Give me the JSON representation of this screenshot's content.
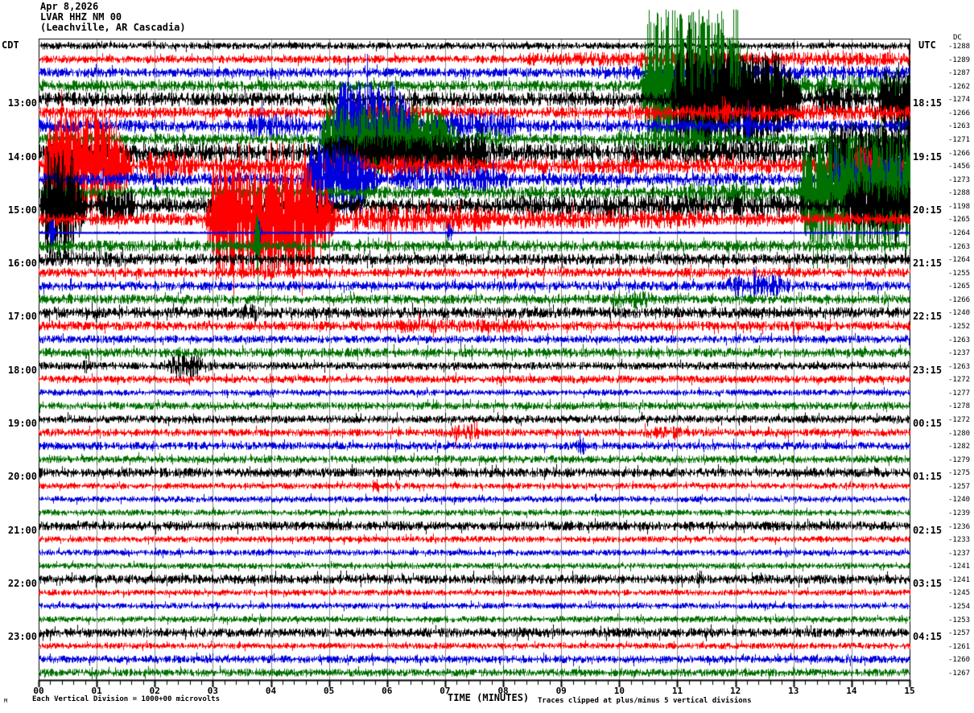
{
  "title": {
    "date": "Apr 8,2026",
    "station": "LVAR HHZ NM 00",
    "location": "(Leachville, AR Cascadia)"
  },
  "header": {
    "left_timezone": "CDT",
    "right_timezone": "UTC",
    "dc_label": "DC"
  },
  "footer": {
    "left": "Each Vertical Division = 1000+00 microvolts",
    "center": "TIME (MINUTES)",
    "right": "Traces clipped at plus/minus 5 vertical divisions",
    "watermark": "M"
  },
  "chart_data": {
    "type": "line",
    "subtype": "helicorder-seismogram",
    "xlabel": "TIME (MINUTES)",
    "x_ticks": [
      "00",
      "01",
      "02",
      "03",
      "04",
      "05",
      "06",
      "07",
      "08",
      "09",
      "10",
      "11",
      "12",
      "13",
      "14",
      "15"
    ],
    "xlim": [
      0,
      15
    ],
    "minutes_per_row": 15,
    "rows_per_hour": 4,
    "grid": true,
    "clip_divisions": 5,
    "colors": {
      "black": "#000000",
      "red": "#ff0000",
      "blue": "#0000dd",
      "green": "#007000",
      "grid": "#8a8a8a"
    },
    "left_time_labels": [
      {
        "row": 5,
        "text": "13:00"
      },
      {
        "row": 9,
        "text": "14:00"
      },
      {
        "row": 13,
        "text": "15:00"
      },
      {
        "row": 17,
        "text": "16:00"
      },
      {
        "row": 21,
        "text": "17:00"
      },
      {
        "row": 25,
        "text": "18:00"
      },
      {
        "row": 29,
        "text": "19:00"
      },
      {
        "row": 33,
        "text": "20:00"
      },
      {
        "row": 37,
        "text": "21:00"
      },
      {
        "row": 41,
        "text": "22:00"
      },
      {
        "row": 45,
        "text": "23:00"
      }
    ],
    "right_time_labels": [
      {
        "row": 5,
        "text": "18:15"
      },
      {
        "row": 9,
        "text": "19:15"
      },
      {
        "row": 13,
        "text": "20:15"
      },
      {
        "row": 17,
        "text": "21:15"
      },
      {
        "row": 21,
        "text": "22:15"
      },
      {
        "row": 25,
        "text": "23:15"
      },
      {
        "row": 29,
        "text": "00:15"
      },
      {
        "row": 33,
        "text": "01:15"
      },
      {
        "row": 37,
        "text": "02:15"
      },
      {
        "row": 41,
        "text": "03:15"
      },
      {
        "row": 45,
        "text": "04:15"
      }
    ],
    "rows": [
      {
        "color": "black",
        "dc": -1288,
        "noise": 4.5,
        "events": []
      },
      {
        "color": "red",
        "dc": -1289,
        "noise": 5,
        "events": [
          [
            8.3,
            15,
            9
          ]
        ]
      },
      {
        "color": "blue",
        "dc": -1287,
        "noise": 6,
        "events": [
          [
            9.5,
            15,
            9
          ]
        ]
      },
      {
        "color": "green",
        "dc": -1262,
        "noise": 7,
        "events": [
          [
            10.35,
            12.4,
            95
          ],
          [
            12.4,
            15,
            14
          ]
        ]
      },
      {
        "color": "black",
        "dc": -1274,
        "noise": 9,
        "events": [
          [
            10.85,
            13.3,
            62
          ],
          [
            13.3,
            14.4,
            20
          ],
          [
            14.4,
            15,
            40
          ]
        ]
      },
      {
        "color": "red",
        "dc": -1266,
        "noise": 7,
        "events": [
          [
            5.3,
            7.0,
            13
          ],
          [
            10,
            15,
            10
          ],
          [
            11.7,
            11.95,
            26
          ]
        ]
      },
      {
        "color": "blue",
        "dc": -1263,
        "noise": 8,
        "events": [
          [
            3.5,
            5.0,
            16
          ],
          [
            5.0,
            6.7,
            55
          ],
          [
            6.7,
            8.6,
            18
          ],
          [
            12.1,
            12.35,
            22
          ]
        ]
      },
      {
        "color": "green",
        "dc": -1271,
        "noise": 7,
        "events": [
          [
            4.8,
            7.4,
            45
          ],
          [
            7.4,
            8.2,
            15
          ],
          [
            9.8,
            12,
            12
          ]
        ]
      },
      {
        "color": "black",
        "dc": -1266,
        "noise": 12,
        "events": [
          [
            4.8,
            8.2,
            22
          ],
          [
            10,
            13.5,
            15
          ],
          [
            13.5,
            15,
            38
          ]
        ]
      },
      {
        "color": "red",
        "dc": -1456,
        "noise": 10,
        "events": [
          [
            0.05,
            1.75,
            70
          ],
          [
            1.75,
            3,
            18
          ],
          [
            5,
            8,
            14
          ],
          [
            13.9,
            14.6,
            25
          ]
        ]
      },
      {
        "color": "blue",
        "dc": -1273,
        "noise": 8,
        "events": [
          [
            4.55,
            6.0,
            45
          ],
          [
            6.0,
            8.5,
            16
          ],
          [
            13.6,
            15,
            34
          ]
        ]
      },
      {
        "color": "green",
        "dc": -1288,
        "noise": 8,
        "events": [
          [
            11,
            13,
            14
          ],
          [
            13.05,
            15,
            72
          ]
        ]
      },
      {
        "color": "black",
        "dc": -1198,
        "noise": 10,
        "events": [
          [
            0,
            0.9,
            70
          ],
          [
            0.9,
            2,
            20
          ],
          [
            8,
            13.8,
            14
          ],
          [
            13.8,
            15,
            32
          ]
        ]
      },
      {
        "color": "red",
        "dc": -1265,
        "noise": 8,
        "events": [
          [
            2.85,
            5.25,
            75
          ],
          [
            5.25,
            8.2,
            18
          ],
          [
            8.2,
            12,
            12
          ]
        ]
      },
      {
        "color": "blue",
        "dc": -1264,
        "noise": 1.5,
        "line": true,
        "events": [
          [
            0.15,
            0.3,
            20
          ],
          [
            3.7,
            3.85,
            26
          ],
          [
            7.0,
            7.15,
            12
          ]
        ]
      },
      {
        "color": "green",
        "dc": -1263,
        "noise": 7,
        "events": [
          [
            0.25,
            0.4,
            16
          ],
          [
            3.7,
            3.82,
            45
          ]
        ]
      },
      {
        "color": "black",
        "dc": -1264,
        "noise": 7,
        "events": [
          [
            0,
            2,
            10
          ]
        ]
      },
      {
        "color": "red",
        "dc": -1255,
        "noise": 6,
        "events": []
      },
      {
        "color": "blue",
        "dc": -1265,
        "noise": 6,
        "events": [
          [
            11.75,
            13.3,
            15
          ]
        ]
      },
      {
        "color": "green",
        "dc": -1266,
        "noise": 6,
        "events": [
          [
            9.7,
            10.9,
            12
          ]
        ]
      },
      {
        "color": "black",
        "dc": -1240,
        "noise": 7,
        "events": [
          [
            3.4,
            3.9,
            14
          ]
        ]
      },
      {
        "color": "red",
        "dc": -1252,
        "noise": 6,
        "events": [
          [
            6,
            9,
            9
          ]
        ]
      },
      {
        "color": "blue",
        "dc": -1263,
        "noise": 5,
        "events": []
      },
      {
        "color": "green",
        "dc": -1237,
        "noise": 6,
        "events": []
      },
      {
        "color": "black",
        "dc": -1263,
        "noise": 5,
        "events": [
          [
            0.7,
            0.95,
            10
          ],
          [
            2.15,
            3.1,
            16
          ]
        ]
      },
      {
        "color": "red",
        "dc": -1272,
        "noise": 5,
        "events": []
      },
      {
        "color": "blue",
        "dc": -1277,
        "noise": 4,
        "events": []
      },
      {
        "color": "green",
        "dc": -1278,
        "noise": 5,
        "events": []
      },
      {
        "color": "black",
        "dc": -1272,
        "noise": 5,
        "events": []
      },
      {
        "color": "red",
        "dc": -1280,
        "noise": 5,
        "events": [
          [
            7.0,
            7.8,
            12
          ],
          [
            10.3,
            11.5,
            8
          ]
        ]
      },
      {
        "color": "blue",
        "dc": -1282,
        "noise": 5,
        "events": [
          [
            9.2,
            9.5,
            11
          ]
        ]
      },
      {
        "color": "green",
        "dc": -1279,
        "noise": 5,
        "events": []
      },
      {
        "color": "black",
        "dc": -1275,
        "noise": 6,
        "events": []
      },
      {
        "color": "red",
        "dc": -1257,
        "noise": 4,
        "events": [
          [
            5.7,
            5.9,
            9
          ]
        ]
      },
      {
        "color": "blue",
        "dc": -1240,
        "noise": 4,
        "events": []
      },
      {
        "color": "green",
        "dc": -1239,
        "noise": 4,
        "events": []
      },
      {
        "color": "black",
        "dc": -1236,
        "noise": 6,
        "events": []
      },
      {
        "color": "red",
        "dc": -1233,
        "noise": 4,
        "events": []
      },
      {
        "color": "blue",
        "dc": -1237,
        "noise": 4,
        "events": []
      },
      {
        "color": "green",
        "dc": -1241,
        "noise": 4,
        "events": []
      },
      {
        "color": "black",
        "dc": -1241,
        "noise": 6,
        "events": [
          [
            11.3,
            11.5,
            13
          ]
        ]
      },
      {
        "color": "red",
        "dc": -1245,
        "noise": 4,
        "events": []
      },
      {
        "color": "blue",
        "dc": -1254,
        "noise": 4,
        "events": []
      },
      {
        "color": "green",
        "dc": -1253,
        "noise": 4,
        "events": []
      },
      {
        "color": "black",
        "dc": -1257,
        "noise": 6,
        "events": []
      },
      {
        "color": "red",
        "dc": -1261,
        "noise": 4,
        "events": []
      },
      {
        "color": "blue",
        "dc": -1260,
        "noise": 5,
        "events": []
      },
      {
        "color": "green",
        "dc": -1267,
        "noise": 5,
        "events": []
      }
    ]
  }
}
